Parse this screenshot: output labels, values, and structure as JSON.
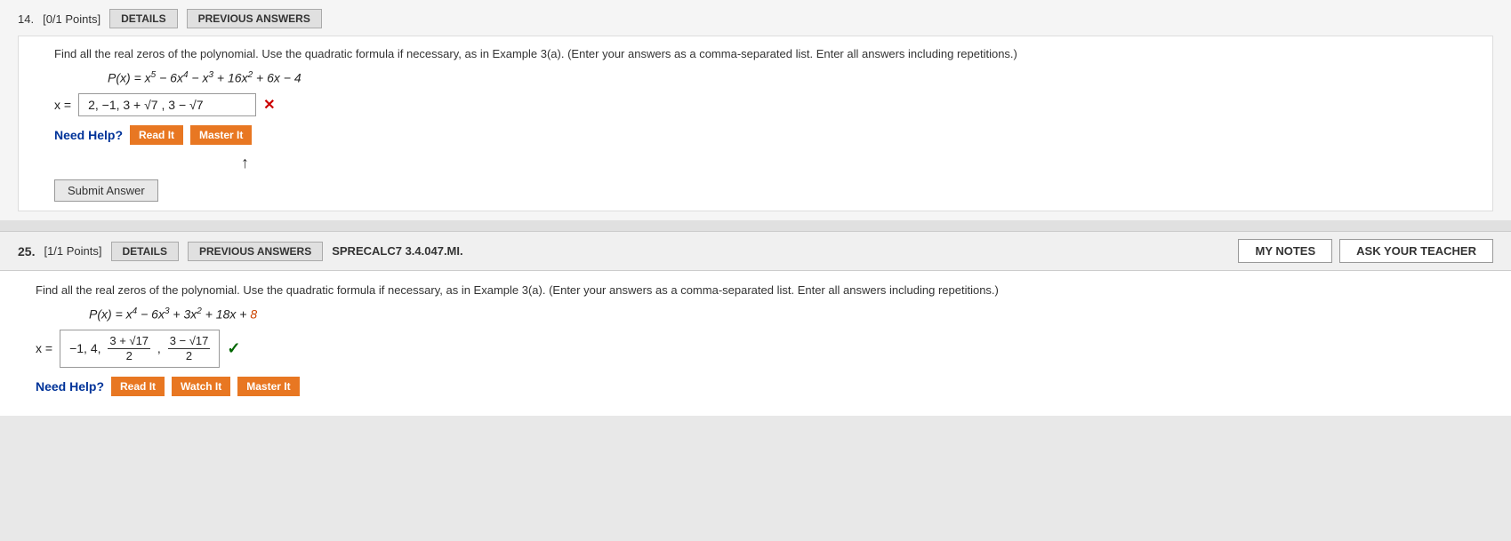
{
  "question24": {
    "number": "14.",
    "points": "[0/1 Points]",
    "details_label": "DETAILS",
    "previous_answers_label": "PREVIOUS ANSWERS",
    "problem_text": "Find all the real zeros of the polynomial. Use the quadratic formula if necessary, as in Example 3(a). (Enter your answers as a comma-separated list. Enter all answers including repetitions.)",
    "polynomial": "P(x) = x⁵ − 6x⁴ − x³ + 16x² + 6x − 4",
    "answer_prefix": "x =",
    "answer_value": "2, −1, 3 + √7 , 3 − √7",
    "mark": "✕",
    "need_help_label": "Need Help?",
    "read_it_label": "Read It",
    "master_it_label": "Master It",
    "submit_label": "Submit Answer"
  },
  "question25": {
    "number": "25.",
    "points": "[1/1 Points]",
    "details_label": "DETAILS",
    "previous_answers_label": "PREVIOUS ANSWERS",
    "source_code": "SPRECALC7 3.4.047.MI.",
    "my_notes_label": "MY NOTES",
    "ask_teacher_label": "ASK YOUR TEACHER",
    "problem_text": "Find all the real zeros of the polynomial. Use the quadratic formula if necessary, as in Example 3(a). (Enter your answers as a comma-separated list. Enter all answers including repetitions.)",
    "polynomial": "P(x) = x⁴ − 6x³ + 3x² + 18x + 8",
    "answer_prefix": "x =",
    "answer_value": "−1, 4,",
    "fraction1_num": "3 + √17",
    "fraction1_den": "2",
    "fraction2_num": "3 − √17",
    "fraction2_den": "2",
    "check": "✓",
    "need_help_label": "Need Help?",
    "read_it_label": "Read It",
    "watch_it_label": "Watch It",
    "master_it_label": "Master It"
  }
}
